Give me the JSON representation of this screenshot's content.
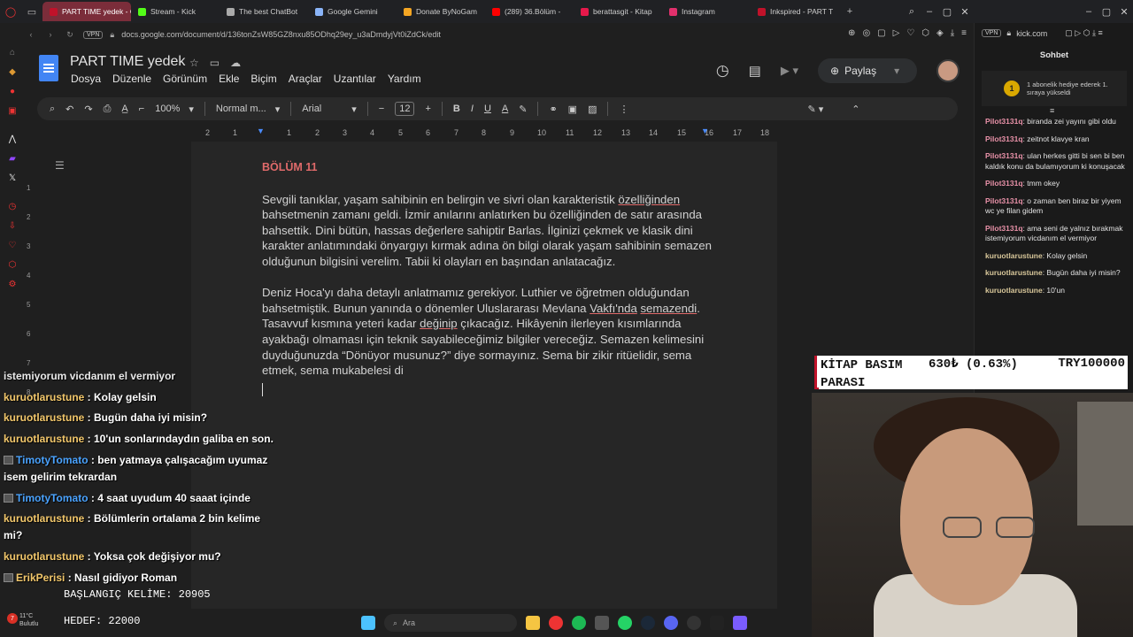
{
  "browser": {
    "tabs": [
      {
        "label": "PART TIME yedek - Goog",
        "color": "#c0122a",
        "active": true
      },
      {
        "label": "Stream - Kick",
        "color": "#53fc18",
        "active": false
      },
      {
        "label": "The best ChatBot",
        "color": "#aaaaaa",
        "active": false
      },
      {
        "label": "Google Gemini",
        "color": "#8ab4f8",
        "active": false
      },
      {
        "label": "Donate ByNoGam",
        "color": "#f5a623",
        "active": false
      },
      {
        "label": "(289) 36.Bölüm -",
        "color": "#ff0000",
        "active": false
      },
      {
        "label": "berattasgit - Kitap",
        "color": "#e6194b",
        "active": false
      },
      {
        "label": "Instagram",
        "color": "#e1306c",
        "active": false
      },
      {
        "label": "Inkspired - PART T",
        "color": "#c0122a",
        "active": false
      }
    ],
    "vpn_label": "VPN",
    "url": "docs.google.com/document/d/136tonZsW85GZ8nxu85ODhq29ey_u3aDmdyjVt0iZdCk/edit"
  },
  "docs": {
    "title": "PART TIME  yedek",
    "menu": [
      "Dosya",
      "Düzenle",
      "Görünüm",
      "Ekle",
      "Biçim",
      "Araçlar",
      "Uzantılar",
      "Yardım"
    ],
    "share_label": "Paylaş",
    "toolbar": {
      "zoom": "100%",
      "style": "Normal m...",
      "font": "Arial",
      "font_size": "12"
    },
    "ruler_numbers": [
      "2",
      "1",
      "1",
      "2",
      "3",
      "4",
      "5",
      "6",
      "7",
      "8",
      "9",
      "10",
      "11",
      "12",
      "13",
      "14",
      "15",
      "16",
      "17",
      "18"
    ],
    "vruler_numbers": [
      "1",
      "2",
      "3",
      "4",
      "5",
      "6",
      "7",
      "8"
    ],
    "chapter": "BÖLÜM 11",
    "p1_a": "Sevgili tanıklar, yaşam sahibinin en belirgin ve sivri olan karakteristik ",
    "p1_u": "özelliğinden",
    "p1_b": " bahsetmenin zamanı geldi. İzmir anılarını anlatırken bu özelliğinden de satır arasında bahsettik. Dini bütün, hassas değerlere sahiptir Barlas. İlginizi çekmek ve klasik dini karakter anlatımındaki önyargıyı kırmak adına ön bilgi olarak yaşam sahibinin semazen olduğunun bilgisini verelim. Tabii ki olayları en başından anlatacağız.",
    "p2_a": "Deniz Hoca'yı daha detaylı anlatmamız gerekiyor. Luthier ve öğretmen olduğundan bahsetmiştik. Bunun yanında o dönemler Uluslararası Mevlana ",
    "p2_u1": "Vakfı'nda",
    "p2_b": " ",
    "p2_u2": "semazendi",
    "p2_c": ". Tasavvuf kısmına yeteri kadar ",
    "p2_u3": "değinip",
    "p2_d": " çıkacağız. Hikâyenin ilerleyen kısımlarında ayakbağı olmaması için teknik sayabileceğimiz bilgiler vereceğiz. Semazen kelimesini duyduğunuzda “Dönüyor musunuz?” diye sormayınız. Sema bir zikir ritüelidir, sema etmek, sema mukabelesi di"
  },
  "chat_overlay": {
    "partial": "istemiyorum vicdanım el vermiyor",
    "lines": [
      {
        "user": "kuruotlarustune",
        "text": " : Kolay gelsin",
        "blue": false,
        "badge": false
      },
      {
        "user": "kuruotlarustune",
        "text": " : Bugün daha iyi misin?",
        "blue": false,
        "badge": false
      },
      {
        "user": "kuruotlarustune",
        "text": " : 10'un sonlarındaydın galiba en son.",
        "blue": false,
        "badge": false
      },
      {
        "user": "TimotyTomato",
        "text": " : ben yatmaya çalışacağım uyumaz",
        "blue": true,
        "badge": true
      },
      {
        "user": "",
        "text": "isem gelirim tekrardan",
        "blue": false,
        "badge": false
      },
      {
        "user": "TimotyTomato",
        "text": " : 4 saat uyudum 40 saaat içinde",
        "blue": true,
        "badge": true
      },
      {
        "user": "kuruotlarustune",
        "text": " : Bölümlerin ortalama 2 bin kelime",
        "blue": false,
        "badge": false
      },
      {
        "user": "",
        "text": "mi?",
        "blue": false,
        "badge": false
      },
      {
        "user": "kuruotlarustune",
        "text": " : Yoksa çok değişiyor mu?",
        "blue": false,
        "badge": false
      },
      {
        "user": "ErikPerisi",
        "text": " : Nasıl gidiyor Roman",
        "blue": false,
        "badge": true
      }
    ]
  },
  "goals": {
    "start_words": "BAŞLANGIÇ KELİME: 20905",
    "target": "HEDEF: 22000"
  },
  "taskbar": {
    "weather_badge": "7",
    "weather_temp": "11°C",
    "weather_desc": "Bulutlu",
    "search_placeholder": "Ara"
  },
  "kick_chat": {
    "url": "kick.com",
    "title": "Sohbet",
    "gift_count": "1",
    "gift_text": "1 abonelik hediye ederek 1. sıraya yükseldi",
    "messages": [
      {
        "user": "Pilot3131q",
        "text": ": biranda zei yayını gibi oldu",
        "k": false
      },
      {
        "user": "Pilot3131q",
        "text": ": zeitnot klavye kran",
        "k": false
      },
      {
        "user": "Pilot3131q",
        "text": ": ulan herkes gitti bi sen bi ben kaldık konu da bulamıyorum ki konuşacak",
        "k": false
      },
      {
        "user": "Pilot3131q",
        "text": ": tmm okey",
        "k": false
      },
      {
        "user": "Pilot3131q",
        "text": ": o zaman ben biraz bir yiyem wc ye filan gidem",
        "k": false
      },
      {
        "user": "Pilot3131q",
        "text": ": ama seni de yalnız bırakmak istemiyorum vicdanım el vermiyor",
        "k": false
      },
      {
        "user": "kuruotlarustune",
        "text": ": Kolay gelsin",
        "k": true
      },
      {
        "user": "kuruotlarustune",
        "text": ": Bugün daha iyi misin?",
        "k": true
      },
      {
        "user": "kuruotlarustune",
        "text": ": 10'un",
        "k": true
      }
    ]
  },
  "donation_goal": {
    "title": "KİTAP BASIM PARASI",
    "amount": "630₺ (0.63%)",
    "target": "TRY100000",
    "progress_fraction": 0.0063,
    "accent": "#c0122a"
  }
}
